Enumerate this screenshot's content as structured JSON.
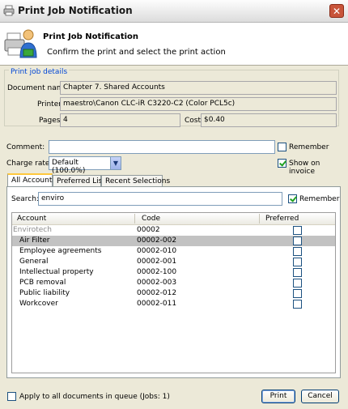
{
  "window": {
    "title": "Print Job Notification",
    "close_glyph": "✕"
  },
  "header": {
    "title": "Print Job Notification",
    "subtitle": "Confirm the print and select the print action"
  },
  "details": {
    "legend": "Print job details",
    "document_name_label": "Document name",
    "document_name": "Chapter 7. Shared Accounts",
    "printer_label": "Printer",
    "printer": "maestro\\Canon CLC-iR C3220-C2 (Color PCL5c)",
    "pages_label": "Pages",
    "pages": "4",
    "cost_label": "Cost",
    "cost": "$0.40"
  },
  "comment": {
    "label": "Comment:",
    "value": "",
    "remember_label": "Remember",
    "remember_checked": false
  },
  "charge": {
    "label": "Charge rate:",
    "selected": "Default (100.0%)",
    "show_on_invoice_label": "Show on invoice",
    "show_on_invoice_checked": true
  },
  "tabs": [
    {
      "label": "All Accounts",
      "active": true
    },
    {
      "label": "Preferred List",
      "active": false
    },
    {
      "label": "Recent Selections",
      "active": false
    }
  ],
  "search": {
    "label": "Search:",
    "value": "enviro",
    "remember_label": "Remember",
    "remember_checked": true
  },
  "table": {
    "columns": [
      "Account",
      "Code",
      "Preferred"
    ],
    "rows": [
      {
        "account": "Envirotech",
        "code": "00002",
        "parent": true,
        "selected": false
      },
      {
        "account": "Air Filter",
        "code": "00002-002",
        "parent": false,
        "selected": true
      },
      {
        "account": "Employee agreements",
        "code": "00002-010",
        "parent": false,
        "selected": false
      },
      {
        "account": "General",
        "code": "00002-001",
        "parent": false,
        "selected": false
      },
      {
        "account": "Intellectual property",
        "code": "00002-100",
        "parent": false,
        "selected": false
      },
      {
        "account": "PCB removal",
        "code": "00002-003",
        "parent": false,
        "selected": false
      },
      {
        "account": "Public liability",
        "code": "00002-012",
        "parent": false,
        "selected": false
      },
      {
        "account": "Workcover",
        "code": "00002-011",
        "parent": false,
        "selected": false
      }
    ]
  },
  "footer": {
    "apply_label": "Apply to all documents in queue (Jobs: 1)",
    "apply_checked": false,
    "print_label": "Print",
    "cancel_label": "Cancel"
  },
  "icons": {
    "window_icon": "printer-icon",
    "header_icon": "printer-user-icon",
    "dropdown_icon": "chevron-down-icon"
  }
}
